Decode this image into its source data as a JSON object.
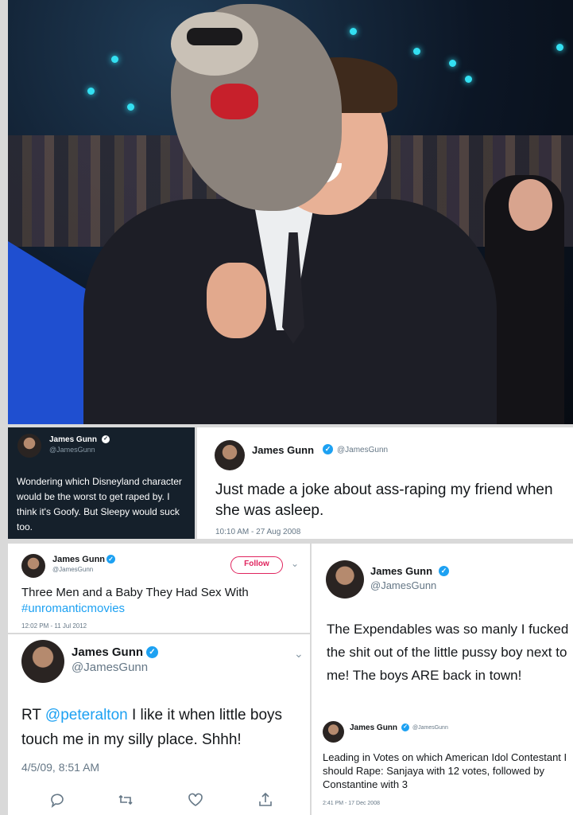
{
  "tweets": [
    {
      "id": "t1",
      "name": "James Gunn",
      "handle": "@JamesGunn",
      "text": "Wondering which Disneyland character would be the worst to get raped by. I think it's Goofy. But Sleepy would suck too."
    },
    {
      "id": "t2",
      "name": "James Gunn",
      "handle": "@JamesGunn",
      "text": "Just made a joke about ass-raping my friend when she was asleep.",
      "timestamp": "10:10 AM - 27 Aug 2008"
    },
    {
      "id": "t3",
      "name": "James Gunn",
      "handle": "@JamesGunn",
      "follow_label": "Follow",
      "text": "Three Men and a Baby They Had Sex With",
      "hashtag": "#unromanticmovies",
      "timestamp": "12:02 PM - 11 Jul 2012"
    },
    {
      "id": "t4",
      "name": "James Gunn",
      "handle": "@JamesGunn",
      "text": "The Expendables was so manly I fucked the shit out of the little pussy boy next to me! The boys ARE back in town!"
    },
    {
      "id": "t5",
      "name": "James Gunn",
      "handle": "@JamesGunn",
      "rt_prefix": "RT",
      "mention": "@peteralton",
      "text": "I like it when little boys touch me in my silly place.  Shhh!",
      "timestamp": "4/5/09, 8:51 AM"
    },
    {
      "id": "t6",
      "name": "James Gunn",
      "handle": "@JamesGunn",
      "text": "Leading in Votes on which American Idol Contestant I should Rape: Sanjaya with 12 votes, followed by Constantine with 3",
      "timestamp": "2:41 PM - 17 Dec 2008"
    }
  ],
  "colors": {
    "twitter_blue": "#1da1f2",
    "dark_card": "#15202b",
    "follow_pink": "#e0245e"
  },
  "icons": [
    "verified-badge-icon",
    "chevron-down-icon",
    "reply-icon",
    "retweet-icon",
    "like-icon",
    "share-icon"
  ]
}
